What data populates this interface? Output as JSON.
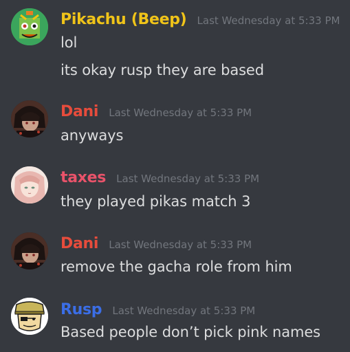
{
  "colors": {
    "background": "#36393f",
    "timestamp": "#72767d",
    "message_text": "#dcddde"
  },
  "messages": [
    {
      "username": "Pikachu (Beep)",
      "username_color": "#f0c419",
      "timestamp": "Last Wednesday at 5:33 PM",
      "avatar": "pikachu-avatar",
      "lines": [
        "lol",
        "its okay rusp they are based"
      ]
    },
    {
      "username": "Dani",
      "username_color": "#e74c3c",
      "timestamp": "Last Wednesday at 5:33 PM",
      "avatar": "dani-avatar",
      "lines": [
        "anyways"
      ]
    },
    {
      "username": "taxes",
      "username_color": "#e9536a",
      "timestamp": "Last Wednesday at 5:33 PM",
      "avatar": "taxes-avatar",
      "lines": [
        "they played pikas match 3"
      ]
    },
    {
      "username": "Dani",
      "username_color": "#e74c3c",
      "timestamp": "Last Wednesday at 5:33 PM",
      "avatar": "dani-avatar",
      "lines": [
        "remove the gacha role from him"
      ]
    },
    {
      "username": "Rusp",
      "username_color": "#3b6ee6",
      "timestamp": "Last Wednesday at 5:33 PM",
      "avatar": "rusp-avatar",
      "lines": [
        "Based people don’t pick pink names"
      ]
    }
  ]
}
